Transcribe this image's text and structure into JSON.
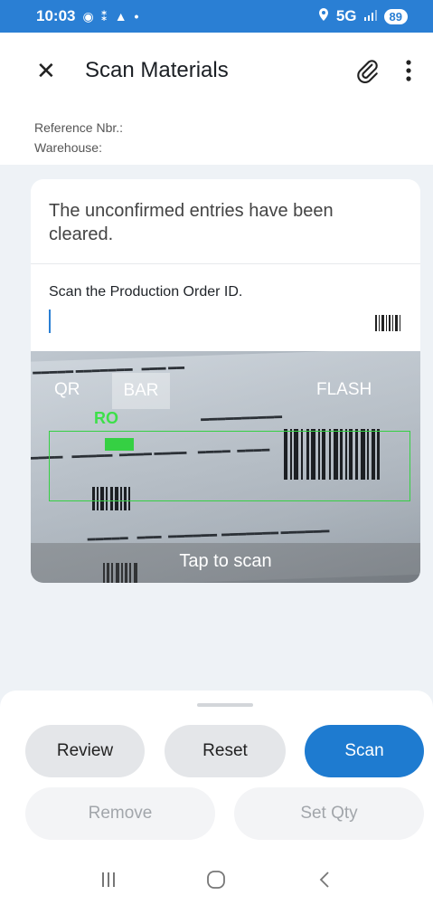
{
  "status_bar": {
    "time": "10:03",
    "left_icons": "◉ ⁑ ▲ •",
    "network": "5G",
    "battery": "89"
  },
  "header": {
    "title": "Scan Materials",
    "close_icon": "close-icon",
    "attach_icon": "paperclip-icon",
    "menu_icon": "more-vertical-icon"
  },
  "info": {
    "reference_label": "Reference Nbr.:",
    "warehouse_label": "Warehouse:"
  },
  "scan_card": {
    "message": "The unconfirmed entries have been cleared.",
    "prompt": "Scan the Production Order ID.",
    "input_value": ""
  },
  "camera": {
    "qr_label": "QR",
    "bar_label": "BAR",
    "flash_label": "FLASH",
    "detected_label": "RO",
    "tap_hint": "Tap to scan"
  },
  "actions": {
    "review": "Review",
    "reset": "Reset",
    "scan": "Scan",
    "remove": "Remove",
    "set_qty": "Set Qty"
  },
  "colors": {
    "primary": "#1e7bd0",
    "status_bar": "#2a7fd4",
    "detect": "#35d043"
  }
}
